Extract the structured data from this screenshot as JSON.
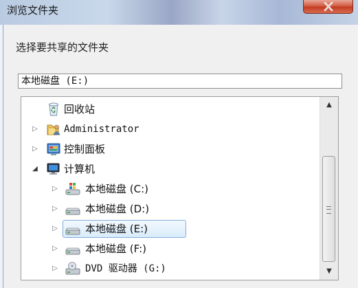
{
  "window": {
    "title": "浏览文件夹"
  },
  "dialog": {
    "prompt": "选择要共享的文件夹",
    "path_value": "本地磁盘 (E:)"
  },
  "tree": {
    "items": [
      {
        "label": "回收站",
        "icon": "recycle-bin-icon",
        "level": 1,
        "expander": "none",
        "selected": false
      },
      {
        "label": "Administrator",
        "icon": "user-folder-icon",
        "level": 1,
        "expander": "collapsed",
        "selected": false
      },
      {
        "label": "控制面板",
        "icon": "control-panel-icon",
        "level": 1,
        "expander": "collapsed",
        "selected": false
      },
      {
        "label": "计算机",
        "icon": "computer-icon",
        "level": 1,
        "expander": "expanded",
        "selected": false
      },
      {
        "label": "本地磁盘 (C:)",
        "icon": "system-drive-icon",
        "level": 2,
        "expander": "collapsed",
        "selected": false
      },
      {
        "label": "本地磁盘 (D:)",
        "icon": "hard-drive-icon",
        "level": 2,
        "expander": "collapsed",
        "selected": false
      },
      {
        "label": "本地磁盘 (E:)",
        "icon": "hard-drive-icon",
        "level": 2,
        "expander": "collapsed",
        "selected": true
      },
      {
        "label": "本地磁盘 (F:)",
        "icon": "hard-drive-icon",
        "level": 2,
        "expander": "collapsed",
        "selected": false
      },
      {
        "label": "DVD 驱动器 (G:)",
        "icon": "dvd-drive-icon",
        "level": 2,
        "expander": "collapsed",
        "selected": false
      }
    ]
  },
  "colors": {
    "selection_border": "#84acdd",
    "close_button": "#c23b22",
    "expander": "#6b6b6b"
  }
}
